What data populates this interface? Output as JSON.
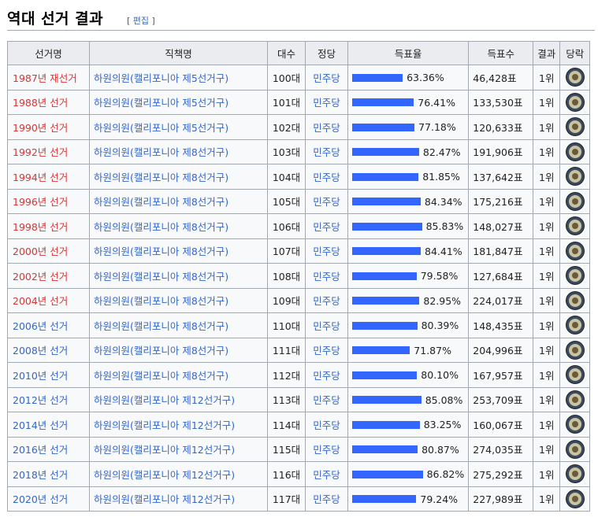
{
  "section": {
    "title": "역대 선거 결과",
    "edit_open": "[ ",
    "edit_label": "편집",
    "edit_close": " ]"
  },
  "table": {
    "headers": [
      "선거명",
      "직책명",
      "대수",
      "정당",
      "득표율",
      "득표수",
      "결과",
      "당락"
    ],
    "rows": [
      {
        "election": "1987년 재선거",
        "link": "red",
        "position": "하원의원(캘리포니아 제5선거구)",
        "session": "100대",
        "party": "민주당",
        "rate_text": "63.36%",
        "rate": 63.36,
        "votes": "46,428표",
        "result": "1위"
      },
      {
        "election": "1988년 선거",
        "link": "red",
        "position": "하원의원(캘리포니아 제5선거구)",
        "session": "101대",
        "party": "민주당",
        "rate_text": "76.41%",
        "rate": 76.41,
        "votes": "133,530표",
        "result": "1위"
      },
      {
        "election": "1990년 선거",
        "link": "red",
        "position": "하원의원(캘리포니아 제5선거구)",
        "session": "102대",
        "party": "민주당",
        "rate_text": "77.18%",
        "rate": 77.18,
        "votes": "120,633표",
        "result": "1위"
      },
      {
        "election": "1992년 선거",
        "link": "red",
        "position": "하원의원(캘리포니아 제8선거구)",
        "session": "103대",
        "party": "민주당",
        "rate_text": "82.47%",
        "rate": 82.47,
        "votes": "191,906표",
        "result": "1위"
      },
      {
        "election": "1994년 선거",
        "link": "red",
        "position": "하원의원(캘리포니아 제8선거구)",
        "session": "104대",
        "party": "민주당",
        "rate_text": "81.85%",
        "rate": 81.85,
        "votes": "137,642표",
        "result": "1위"
      },
      {
        "election": "1996년 선거",
        "link": "red",
        "position": "하원의원(캘리포니아 제8선거구)",
        "session": "105대",
        "party": "민주당",
        "rate_text": "84.34%",
        "rate": 84.34,
        "votes": "175,216표",
        "result": "1위"
      },
      {
        "election": "1998년 선거",
        "link": "red",
        "position": "하원의원(캘리포니아 제8선거구)",
        "session": "106대",
        "party": "민주당",
        "rate_text": "85.83%",
        "rate": 85.83,
        "votes": "148,027표",
        "result": "1위"
      },
      {
        "election": "2000년 선거",
        "link": "red",
        "position": "하원의원(캘리포니아 제8선거구)",
        "session": "107대",
        "party": "민주당",
        "rate_text": "84.41%",
        "rate": 84.41,
        "votes": "181,847표",
        "result": "1위"
      },
      {
        "election": "2002년 선거",
        "link": "red",
        "position": "하원의원(캘리포니아 제8선거구)",
        "session": "108대",
        "party": "민주당",
        "rate_text": "79.58%",
        "rate": 79.58,
        "votes": "127,684표",
        "result": "1위"
      },
      {
        "election": "2004년 선거",
        "link": "red",
        "position": "하원의원(캘리포니아 제8선거구)",
        "session": "109대",
        "party": "민주당",
        "rate_text": "82.95%",
        "rate": 82.95,
        "votes": "224,017표",
        "result": "1위"
      },
      {
        "election": "2006년 선거",
        "link": "blue",
        "position": "하원의원(캘리포니아 제8선거구)",
        "session": "110대",
        "party": "민주당",
        "rate_text": "80.39%",
        "rate": 80.39,
        "votes": "148,435표",
        "result": "1위"
      },
      {
        "election": "2008년 선거",
        "link": "blue",
        "position": "하원의원(캘리포니아 제8선거구)",
        "session": "111대",
        "party": "민주당",
        "rate_text": "71.87%",
        "rate": 71.87,
        "votes": "204,996표",
        "result": "1위"
      },
      {
        "election": "2010년 선거",
        "link": "blue",
        "position": "하원의원(캘리포니아 제8선거구)",
        "session": "112대",
        "party": "민주당",
        "rate_text": "80.10%",
        "rate": 80.1,
        "votes": "167,957표",
        "result": "1위"
      },
      {
        "election": "2012년 선거",
        "link": "blue",
        "position": "하원의원(캘리포니아 제12선거구)",
        "session": "113대",
        "party": "민주당",
        "rate_text": "85.08%",
        "rate": 85.08,
        "votes": "253,709표",
        "result": "1위"
      },
      {
        "election": "2014년 선거",
        "link": "blue",
        "position": "하원의원(캘리포니아 제12선거구)",
        "session": "114대",
        "party": "민주당",
        "rate_text": "83.25%",
        "rate": 83.25,
        "votes": "160,067표",
        "result": "1위"
      },
      {
        "election": "2016년 선거",
        "link": "blue",
        "position": "하원의원(캘리포니아 제12선거구)",
        "session": "115대",
        "party": "민주당",
        "rate_text": "80.87%",
        "rate": 80.87,
        "votes": "274,035표",
        "result": "1위"
      },
      {
        "election": "2018년 선거",
        "link": "blue",
        "position": "하원의원(캘리포니아 제12선거구)",
        "session": "116대",
        "party": "민주당",
        "rate_text": "86.82%",
        "rate": 86.82,
        "votes": "275,292표",
        "result": "1위"
      },
      {
        "election": "2020년 선거",
        "link": "blue",
        "position": "하원의원(캘리포니아 제12선거구)",
        "session": "117대",
        "party": "민주당",
        "rate_text": "79.24%",
        "rate": 79.24,
        "votes": "227,989표",
        "result": "1위"
      }
    ]
  },
  "colors": {
    "bar": "#3366ff",
    "link_blue": "#3366cc",
    "link_red": "#dd3333",
    "header_bg": "#eaecf0",
    "border": "#a2a9b1"
  },
  "icons": {
    "outcome": "house-seal-icon"
  }
}
